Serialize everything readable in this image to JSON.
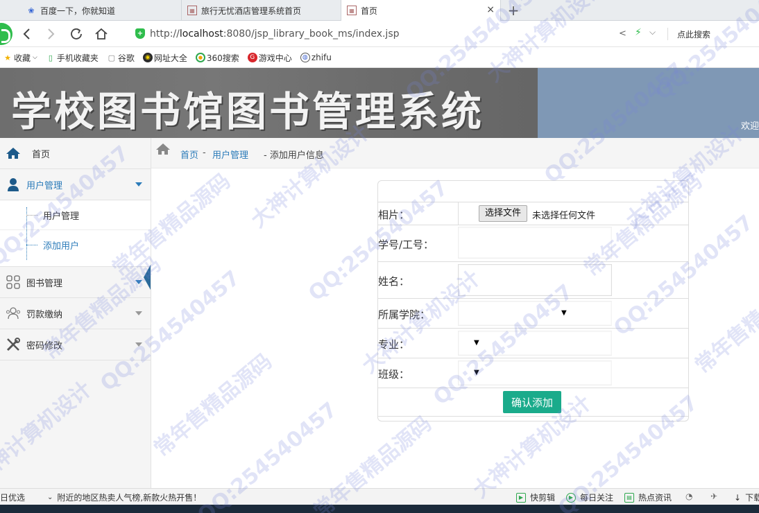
{
  "browser": {
    "tabs": [
      {
        "title": "百度一下，你就知道",
        "active": false
      },
      {
        "title": "旅行无忧酒店管理系统首页",
        "active": false
      },
      {
        "title": "首页",
        "active": true
      }
    ],
    "new_tab": "+",
    "close": "×",
    "url_host_prefix": "http://",
    "url_host": "localhost",
    "url_rest": ":8080/jsp_library_book_ms/index.jsp",
    "search_label": "点此搜索",
    "bookmarks": [
      "收藏",
      "手机收藏夹",
      "谷歌",
      "网址大全",
      "360搜索",
      "游戏中心",
      "zhifu"
    ]
  },
  "banner": {
    "title": "学校图书馆图书管理系统",
    "welcome": "欢迎"
  },
  "sidebar": {
    "home": "首页",
    "user_mgmt": "用户管理",
    "sub_items": [
      "用户管理",
      "添加用户"
    ],
    "book_mgmt": "图书管理",
    "fine": "罚款缴纳",
    "password": "密码修改"
  },
  "breadcrumb": {
    "home": "首页",
    "sep": "-",
    "users": "用户管理",
    "current": "- 添加用户信息"
  },
  "form": {
    "photo_label": "相片：",
    "file_button": "选择文件",
    "file_status": "未选择任何文件",
    "id_label": "学号/工号：",
    "name_label": "姓名：",
    "college_label": "所属学院：",
    "major_label": "专业：",
    "class_label": "班级：",
    "submit": "确认添加"
  },
  "statusbar": {
    "left1": "日优选",
    "left2": "附近的地区热卖人气榜,新款火热开售！",
    "items": [
      "快剪辑",
      "每日关注",
      "热点资讯",
      "下载"
    ]
  },
  "watermark": {
    "texts": [
      "QQ:254540457",
      "大神计算机设计",
      "常年售精品源码"
    ]
  },
  "colors": {
    "accent": "#2b7bb9",
    "button": "#1aab8b",
    "banner_bg": "#7f98b5"
  }
}
